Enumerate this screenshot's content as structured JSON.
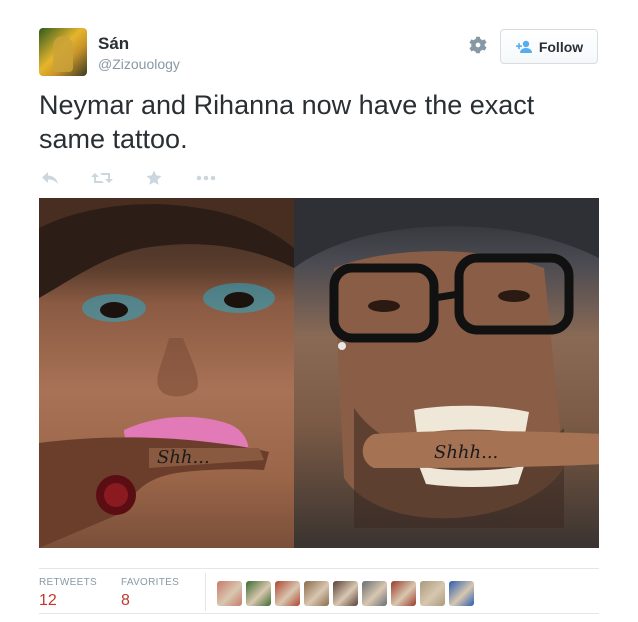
{
  "user": {
    "display_name": "Sán",
    "handle": "@Zizouology"
  },
  "follow_button": {
    "label": "Follow"
  },
  "tweet": {
    "text": "Neymar and Rihanna now have the exact same tattoo."
  },
  "actions": [
    {
      "icon": "reply-icon"
    },
    {
      "icon": "retweet-icon"
    },
    {
      "icon": "favorite-star-icon"
    },
    {
      "icon": "more-options-icon"
    }
  ],
  "media": {
    "left_photo_caption": "Shh...",
    "right_photo_caption": "Shhh..."
  },
  "stats": {
    "retweets_label": "RETWEETS",
    "retweets_value": "12",
    "favorites_label": "FAVORITES",
    "favorites_value": "8"
  },
  "favoriters": [
    {
      "color": "#c77b6a"
    },
    {
      "color": "#3d6b2e"
    },
    {
      "color": "#b04530"
    },
    {
      "color": "#8a6b4a"
    },
    {
      "color": "#5a4038"
    },
    {
      "color": "#6a6e73"
    },
    {
      "color": "#9a3b2a"
    },
    {
      "color": "#a89a7a"
    },
    {
      "color": "#2a5db0"
    }
  ],
  "colors": {
    "accent": "#55acee",
    "stat_value": "#c0392b",
    "muted": "#8899a6"
  }
}
